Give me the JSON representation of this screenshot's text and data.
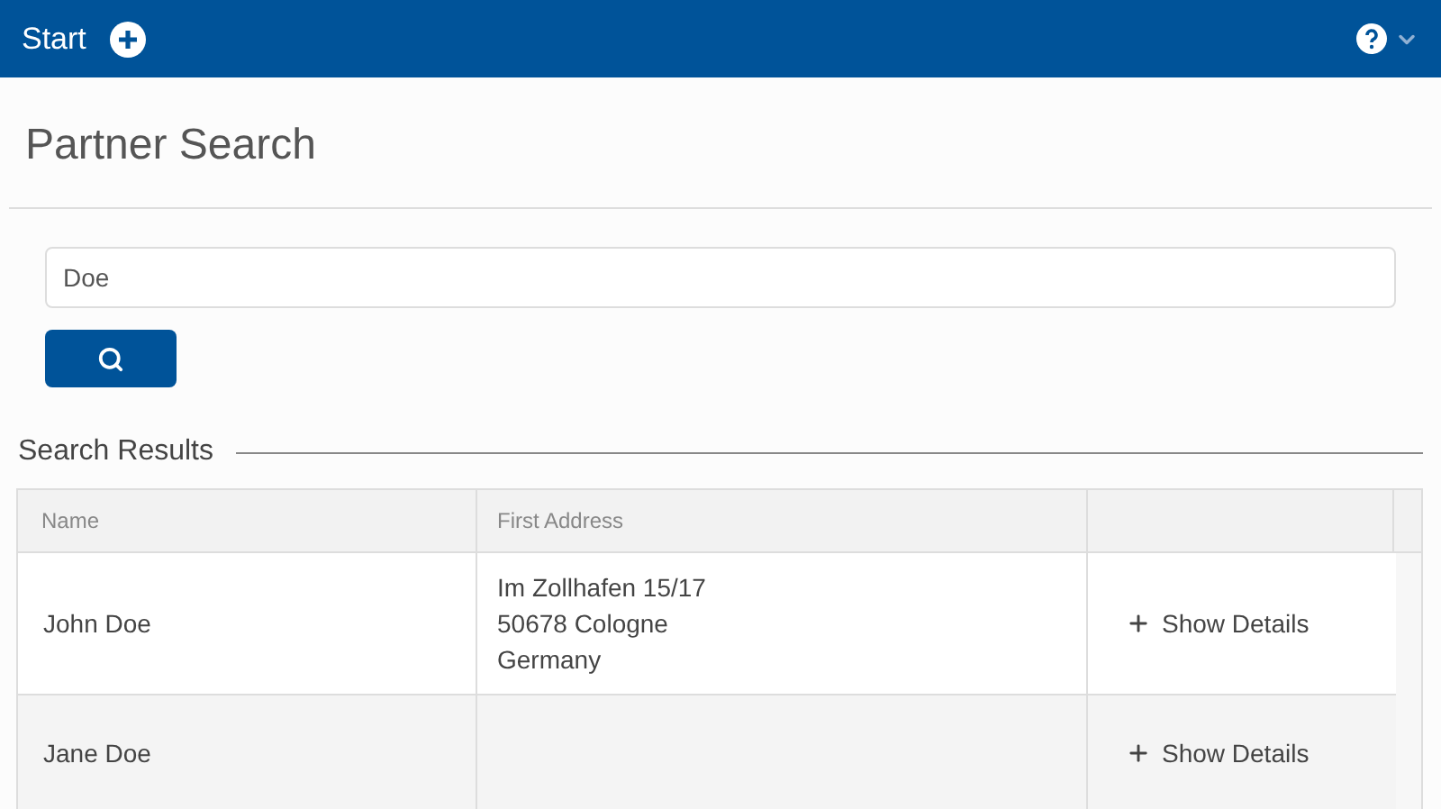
{
  "header": {
    "title": "Start"
  },
  "page_title": "Partner Search",
  "search": {
    "value": "Doe"
  },
  "results": {
    "title": "Search Results",
    "columns": [
      "Name",
      "First Address"
    ],
    "rows": [
      {
        "name": "John Doe",
        "address": [
          "Im Zollhafen 15/17",
          "50678 Cologne",
          "Germany"
        ],
        "action": "Show Details"
      },
      {
        "name": "Jane Doe",
        "address": [],
        "action": "Show Details"
      }
    ]
  }
}
